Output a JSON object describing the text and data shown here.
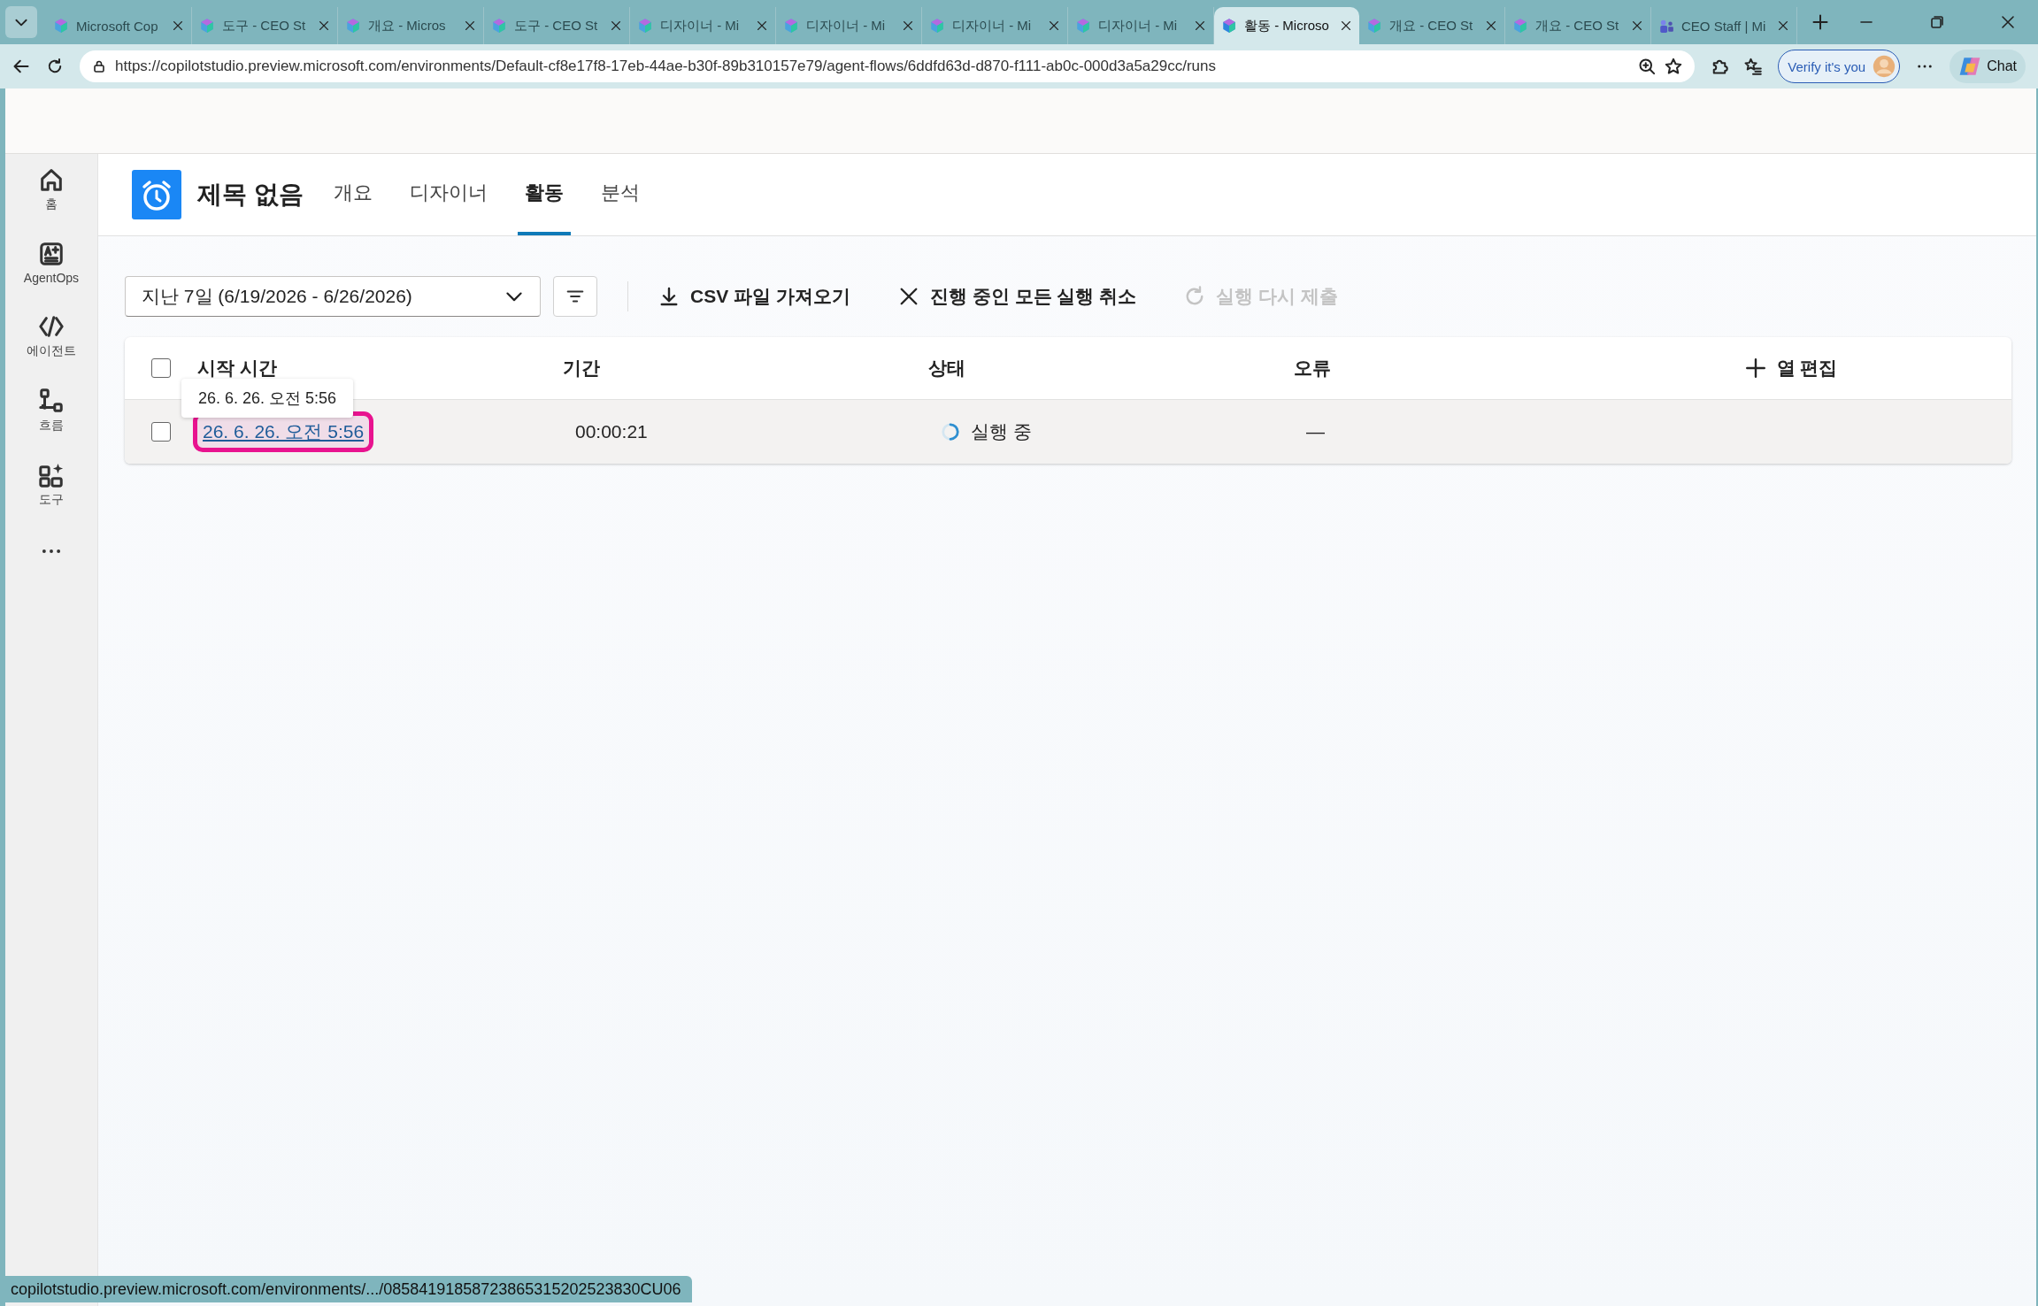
{
  "browser": {
    "tabs": [
      {
        "title": "Microsoft Cop",
        "selected": false
      },
      {
        "title": "도구 - CEO St",
        "selected": false
      },
      {
        "title": "개요 - Micros",
        "selected": false
      },
      {
        "title": "도구 - CEO St",
        "selected": false
      },
      {
        "title": "디자이너 - Mi",
        "selected": false
      },
      {
        "title": "디자이너 - Mi",
        "selected": false
      },
      {
        "title": "디자이너 - Mi",
        "selected": false
      },
      {
        "title": "디자이너 - Mi",
        "selected": false
      },
      {
        "title": "활동 - Microso",
        "selected": true
      },
      {
        "title": "개요 - CEO St",
        "selected": false
      },
      {
        "title": "개요 - CEO St",
        "selected": false
      },
      {
        "title": "CEO Staff | Mi",
        "selected": false
      }
    ],
    "url": "https://copilotstudio.preview.microsoft.com/environments/Default-cf8e17f8-17eb-44ae-b30f-89b310157e79/agent-flows/6ddfd63d-d870-f111-ab0c-000d3a5a29cc/runs",
    "verify_button": "Verify it's you",
    "chat_button": "Chat"
  },
  "nav": [
    "홈",
    "AgentOps",
    "에이전트",
    "흐름",
    "도구"
  ],
  "header": {
    "title": "제목 없음",
    "tabs": [
      {
        "label": "개요",
        "selected": false
      },
      {
        "label": "디자이너",
        "selected": false
      },
      {
        "label": "활동",
        "selected": true
      },
      {
        "label": "분석",
        "selected": false
      }
    ]
  },
  "toolbar": {
    "date_range": "지난 7일 (6/19/2026 - 6/26/2026)",
    "actions": [
      {
        "label": "CSV 파일 가져오기",
        "disabled": false
      },
      {
        "label": "진행 중인 모든 실행 취소",
        "disabled": false
      },
      {
        "label": "실행 다시 제출",
        "disabled": true
      }
    ]
  },
  "table": {
    "select_all_checked": false,
    "columns": [
      "시작 시간",
      "기간",
      "상태",
      "오류"
    ],
    "edit_columns": "열 편집",
    "rows": [
      {
        "checked": false,
        "start_time": "26. 6. 26. 오전 5:56",
        "focused": true,
        "duration": "00:00:21",
        "status": "실행 중",
        "error": "—"
      }
    ]
  },
  "tooltip": "26. 6. 26. 오전 5:56",
  "status_bar": "copilotstudio.preview.microsoft.com/environments/.../08584191858723865315202523830CU06"
}
